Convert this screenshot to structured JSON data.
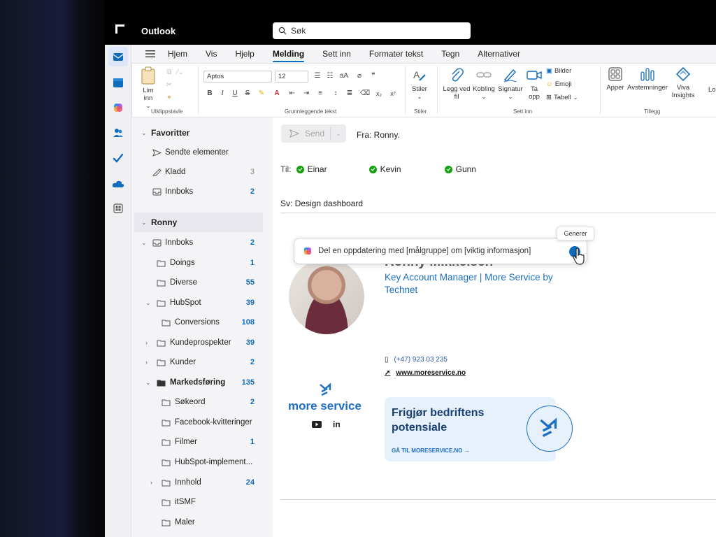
{
  "app": {
    "name": "Outlook"
  },
  "search": {
    "placeholder": "Søk"
  },
  "menu": {
    "tabs": [
      "Hjem",
      "Vis",
      "Hjelp",
      "Melding",
      "Sett inn",
      "Formater tekst",
      "Tegn",
      "Alternativer"
    ],
    "active": "Melding"
  },
  "ribbon": {
    "paste": "Lim inn",
    "font": "Aptos",
    "size": "12",
    "stiler": "Stiler",
    "attach": "Legg ved fil",
    "link": "Kobling",
    "signature": "Signatur",
    "take": "Ta opp",
    "pictures": "Bilder",
    "emoji": "Emoji",
    "table": "Tabell",
    "apps": "Apper",
    "polls": "Avstemninger",
    "viva": "Viva Insights",
    "truncated": "Lo",
    "groups": [
      "Utklippstavle",
      "Grunnleggende tekst",
      "Stiler",
      "Sett inn",
      "Tillegg"
    ]
  },
  "folders": {
    "favorites_header": "Favoritter",
    "favorites": [
      {
        "label": "Sendte elementer",
        "count": ""
      },
      {
        "label": "Kladd",
        "count": "3"
      },
      {
        "label": "Innboks",
        "count": "2"
      }
    ],
    "account": "Ronny",
    "inbox": {
      "label": "Innboks",
      "count": "2"
    },
    "tree": [
      {
        "label": "Doings",
        "count": "1"
      },
      {
        "label": "Diverse",
        "count": "55"
      },
      {
        "label": "HubSpot",
        "count": "39"
      },
      {
        "label": "Conversions",
        "count": "108"
      },
      {
        "label": "Kundeprospekter",
        "count": "39"
      },
      {
        "label": "Kunder",
        "count": "2"
      },
      {
        "label": "Markedsføring",
        "count": "135"
      },
      {
        "label": "Søkeord",
        "count": "2"
      },
      {
        "label": "Facebook-kvitteringer",
        "count": ""
      },
      {
        "label": "Filmer",
        "count": "1"
      },
      {
        "label": "HubSpot-implement...",
        "count": ""
      },
      {
        "label": "Innhold",
        "count": "24"
      },
      {
        "label": "itSMF",
        "count": ""
      },
      {
        "label": "Maler",
        "count": ""
      }
    ]
  },
  "compose": {
    "send": "Send",
    "from": "Fra: Ronny.",
    "to_label": "Til:",
    "recipients": [
      "Einar",
      "Kevin",
      "Gunn"
    ],
    "subject": "Sv: Design dashboard",
    "copilot_prompt": "Del en oppdatering med [målgruppe] om [viktig informasjon]",
    "generate_tooltip": "Generer"
  },
  "signature": {
    "name_partial": "Ronny Mikkelsen",
    "title": "Key Account Manager | More Service by Technet",
    "phone": "(+47) 923 03 235",
    "website": "www.moreservice.no",
    "brand": "more service",
    "banner_title": "Frigjør bedriftens potensiale",
    "banner_link": "GÅ TIL MORESERVICE.NO →"
  },
  "colors": {
    "accent": "#0f6cbd",
    "brand": "#1c6fc1",
    "ok": "#13a10e"
  }
}
